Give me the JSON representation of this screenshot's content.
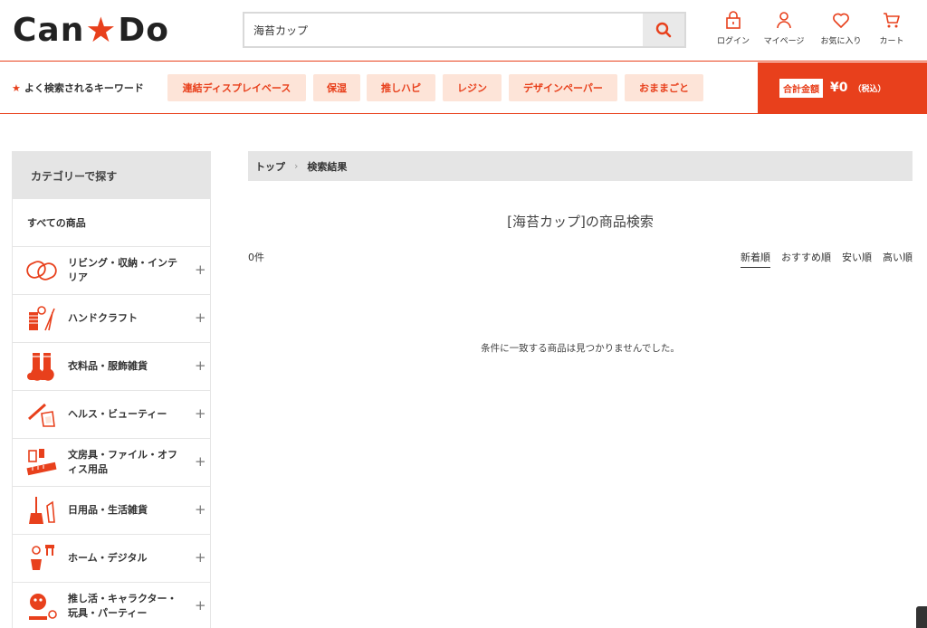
{
  "header": {
    "logo_left": "Can",
    "logo_star": "★",
    "logo_right": "Do",
    "search_value": "海苔カップ",
    "icons": [
      {
        "name": "login-icon",
        "label": "ログイン"
      },
      {
        "name": "mypage-icon",
        "label": "マイページ"
      },
      {
        "name": "favorite-icon",
        "label": "お気に入り"
      },
      {
        "name": "cart-icon",
        "label": "カート"
      }
    ]
  },
  "keywords": {
    "title": "よく検索されるキーワード",
    "items": [
      "連結ディスプレイベース",
      "保湿",
      "推しハピ",
      "レジン",
      "デザインペーパー",
      "おままごと"
    ]
  },
  "total": {
    "label": "合計金額",
    "value": "¥0",
    "tax": "（税込）"
  },
  "sidebar": {
    "heading": "カテゴリーで探す",
    "all": "すべての商品",
    "categories": [
      {
        "label": "リビング・収納・インテリア",
        "icon": "living-icon"
      },
      {
        "label": "ハンドクラフト",
        "icon": "handcraft-icon"
      },
      {
        "label": "衣料品・服飾雑貨",
        "icon": "clothing-icon"
      },
      {
        "label": "ヘルス・ビューティー",
        "icon": "beauty-icon"
      },
      {
        "label": "文房具・ファイル・オフィス用品",
        "icon": "stationery-icon"
      },
      {
        "label": "日用品・生活雑貨",
        "icon": "daily-goods-icon"
      },
      {
        "label": "ホーム・デジタル",
        "icon": "home-digital-icon"
      },
      {
        "label": "推し活・キャラクター・玩具・パーティー",
        "icon": "character-toy-icon"
      }
    ]
  },
  "main": {
    "breadcrumb": [
      "トップ",
      "検索結果"
    ],
    "breadcrumb_sep": "›",
    "title": "[海苔カップ]の商品検索",
    "count": "0件",
    "sorts": [
      "新着順",
      "おすすめ順",
      "安い順",
      "高い順"
    ],
    "active_sort": "新着順",
    "no_result": "条件に一致する商品は見つかりませんでした。"
  },
  "colors": {
    "accent": "#e8401c",
    "accent_light": "#fde4d8",
    "gray_bar": "#e5e5e5"
  }
}
